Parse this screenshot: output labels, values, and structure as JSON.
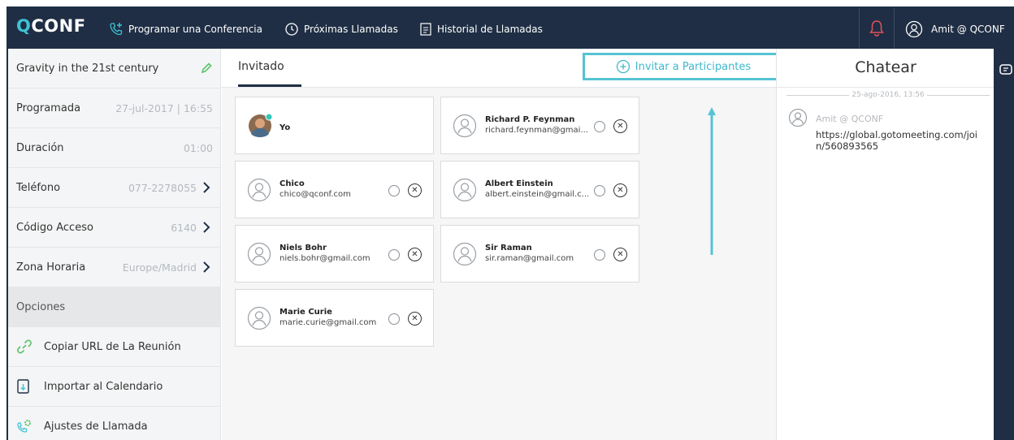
{
  "topbar": {
    "logo_q": "Q",
    "logo_rest": "CONF",
    "nav": [
      {
        "label": "Programar una Conferencia",
        "icon": "phone-plus-icon"
      },
      {
        "label": "Próximas Llamadas",
        "icon": "clock-icon"
      },
      {
        "label": "Historial de Llamadas",
        "icon": "document-icon"
      }
    ],
    "user": "Amit @ QCONF",
    "accent": "#3ec2d4",
    "bg": "#1f2e44",
    "bell_color": "#e2525a"
  },
  "sidebar": {
    "title": "Gravity in the 21st century",
    "rows": [
      {
        "label": "Programada",
        "value": "27-jul-2017 | 16:55"
      },
      {
        "label": "Duración",
        "value": "01:00"
      },
      {
        "label": "Teléfono",
        "value": "077-2278055"
      },
      {
        "label": "Código Acceso",
        "value": "6140"
      },
      {
        "label": "Zona Horaria",
        "value": "Europe/Madrid"
      }
    ],
    "options_label": "Opciones",
    "options": [
      {
        "label": "Copiar URL de La Reunión",
        "icon": "link-icon"
      },
      {
        "label": "Importar al Calendario",
        "icon": "calendar-import-icon"
      },
      {
        "label": "Ajustes de Llamada",
        "icon": "call-settings-icon"
      }
    ]
  },
  "main": {
    "tab_label": "Invitado",
    "invite_label": "Invitar a Participantes",
    "participants": [
      {
        "name": "Yo",
        "email": ""
      },
      {
        "name": "Richard P. Feynman",
        "email": "richard.feynman@gmai..."
      },
      {
        "name": "Chico",
        "email": "chico@qconf.com"
      },
      {
        "name": "Albert Einstein",
        "email": "albert.einstein@gmail.c..."
      },
      {
        "name": "Niels Bohr",
        "email": "niels.bohr@gmail.com"
      },
      {
        "name": "Sir Raman",
        "email": "sir.raman@gmail.com"
      },
      {
        "name": "Marie Curie",
        "email": "marie.curie@gmail.com"
      }
    ]
  },
  "chat": {
    "title": "Chatear",
    "date": "25-ago-2016, 13:56",
    "messages": [
      {
        "user": "Amit @ QCONF",
        "text": "https://global.gotomeeting.com/join/560893565"
      }
    ]
  }
}
